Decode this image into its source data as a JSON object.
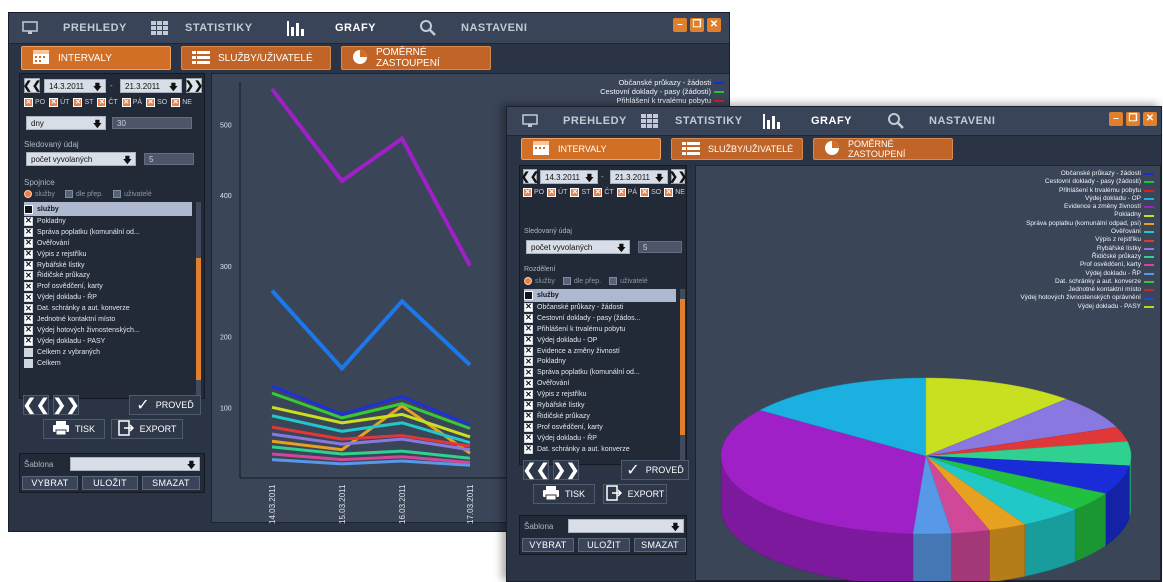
{
  "tabs": [
    {
      "label": "PREHLEDY",
      "icon": "monitor-icon"
    },
    {
      "label": "STATISTIKY",
      "icon": "grid-icon"
    },
    {
      "label": "GRAFY",
      "icon": "bar-chart-icon",
      "active": true
    },
    {
      "label": "NASTAVENI",
      "icon": "wrench-icon"
    }
  ],
  "subtabs": {
    "intervals": "INTERVALY",
    "services": "SLUŽBY/UŽIVATELÉ",
    "ratio": "POMĚRNÉ ZASTOUPENÍ"
  },
  "date_from": "14.3.2011",
  "date_to": "21.3.2011",
  "date_sep": "-",
  "days": [
    "PO",
    "ÚT",
    "ST",
    "ČT",
    "PÁ",
    "SO",
    "NE"
  ],
  "period_unit": "dny",
  "period_count": "30",
  "tracked_label": "Sledovaný údaj",
  "tracked_value": "počet vyvolaných",
  "tracked_count": "5",
  "w1_group_label": "Spojnice",
  "w2_group_label": "Rozdělení",
  "radios": [
    "služby",
    "dle přep.",
    "uživatelé"
  ],
  "list_header": "služby",
  "list_w1": [
    {
      "label": "Pokladny",
      "checked": true
    },
    {
      "label": "Správa poplatku (komunální od...",
      "checked": true
    },
    {
      "label": "Ověřování",
      "checked": true
    },
    {
      "label": "Výpis z rejstříku",
      "checked": true
    },
    {
      "label": "Rybářské lístky",
      "checked": true
    },
    {
      "label": "Řidičské průkazy",
      "checked": true
    },
    {
      "label": "Prof osvědčení, karty",
      "checked": true
    },
    {
      "label": "Výdej dokladu - ŘP",
      "checked": true
    },
    {
      "label": "Dat. schránky a aut. konverze",
      "checked": true
    },
    {
      "label": "Jednotné kontaktní místo",
      "checked": true
    },
    {
      "label": "Výdej hotových živnostenských...",
      "checked": true
    },
    {
      "label": "Výdej dokladu - PASY",
      "checked": true
    },
    {
      "label": "Celkem z vybraných",
      "checked": false
    },
    {
      "label": "Celkem",
      "checked": false
    }
  ],
  "list_w2": [
    {
      "label": "Občanské průkazy - žádosti",
      "checked": true
    },
    {
      "label": "Cestovní doklady - pasy (žádos...",
      "checked": true
    },
    {
      "label": "Přihlášení k trvalému pobytu",
      "checked": true
    },
    {
      "label": "Výdej dokladu - OP",
      "checked": true
    },
    {
      "label": "Evidence a změny živností",
      "checked": true
    },
    {
      "label": "Pokladny",
      "checked": true
    },
    {
      "label": "Správa poplatku (komunální od...",
      "checked": true
    },
    {
      "label": "Ověřování",
      "checked": true
    },
    {
      "label": "Výpis z rejstříku",
      "checked": true
    },
    {
      "label": "Rybářské lístky",
      "checked": true
    },
    {
      "label": "Řidičské průkazy",
      "checked": true
    },
    {
      "label": "Prof osvědčení, karty",
      "checked": true
    },
    {
      "label": "Výdej dokladu - ŘP",
      "checked": true
    },
    {
      "label": "Dat. schránky a aut. konverze",
      "checked": true
    }
  ],
  "run_label": "PROVEĎ",
  "print_label": "TISK",
  "export_label": "EXPORT",
  "template_label": "Šablona",
  "template_buttons": [
    "VYBRAT",
    "ULOŽIT",
    "SMAZAT"
  ],
  "colors": {
    "accent": "#e0802c",
    "bg": "#2b3444",
    "plot": "#3a4558"
  },
  "chart_w1": {
    "type": "line",
    "x": [
      "14.03.2011",
      "15.03.2011",
      "16.03.2011",
      "17.03.2011"
    ],
    "yticks": [
      100,
      200,
      300,
      400,
      500
    ],
    "ylim": [
      0,
      560
    ],
    "legend": [
      {
        "name": "Občanské průkazy - žádosti",
        "color": "#1a2bd8"
      },
      {
        "name": "Cestovní doklady - pasy (žádosti)",
        "color": "#22c040"
      },
      {
        "name": "Přihlášení k trvalému pobytu",
        "color": "#d82020"
      }
    ],
    "series": [
      {
        "color": "#a020c8",
        "values": [
          550,
          420,
          480,
          300
        ]
      },
      {
        "color": "#1c78e8",
        "values": [
          265,
          155,
          250,
          160
        ]
      },
      {
        "color": "#2030d8",
        "values": [
          130,
          90,
          115,
          75
        ]
      },
      {
        "color": "#38c838",
        "values": [
          120,
          85,
          105,
          70
        ]
      },
      {
        "color": "#c8e020",
        "values": [
          100,
          78,
          90,
          58
        ]
      },
      {
        "color": "#20c8c8",
        "values": [
          88,
          66,
          78,
          50
        ]
      },
      {
        "color": "#e03838",
        "values": [
          72,
          55,
          60,
          45
        ]
      },
      {
        "color": "#8878e0",
        "values": [
          62,
          48,
          55,
          40
        ]
      },
      {
        "color": "#e8a020",
        "values": [
          52,
          40,
          102,
          35
        ]
      },
      {
        "color": "#30d090",
        "values": [
          44,
          34,
          38,
          28
        ]
      },
      {
        "color": "#d04898",
        "values": [
          34,
          26,
          30,
          22
        ]
      },
      {
        "color": "#5898e8",
        "values": [
          26,
          20,
          24,
          18
        ]
      }
    ]
  },
  "chart_w2": {
    "type": "pie",
    "legend": [
      {
        "name": "Občanské průkazy - žádosti",
        "color": "#1a2bd8"
      },
      {
        "name": "Cestovní doklady - pasy (žádosti)",
        "color": "#22c040"
      },
      {
        "name": "Přihlášení k trvalému pobytu",
        "color": "#d82020"
      },
      {
        "name": "Výdej dokladu - OP",
        "color": "#1ab0e0"
      },
      {
        "name": "Evidence a změny živností",
        "color": "#a020c8"
      },
      {
        "name": "Pokladny",
        "color": "#c8e020"
      },
      {
        "name": "Správa poplatku (komunální odpad, psi)",
        "color": "#e8a020"
      },
      {
        "name": "Ověřování",
        "color": "#20c8c8"
      },
      {
        "name": "Výpis z rejstříku",
        "color": "#e03838"
      },
      {
        "name": "Rybářské lístky",
        "color": "#8878e0"
      },
      {
        "name": "Řidičské průkazy",
        "color": "#30d090"
      },
      {
        "name": "Prof osvědčení, karty",
        "color": "#d04898"
      },
      {
        "name": "Výdej dokladu - ŘP",
        "color": "#5898e8"
      },
      {
        "name": "Dat. schránky a aut. konverze",
        "color": "#40c040"
      },
      {
        "name": "Jednotné kontaktní místo",
        "color": "#c82828"
      },
      {
        "name": "Výdej hotových živnostenských oprávnění",
        "color": "#2048d0"
      },
      {
        "name": "Výdej dokladu - PASY",
        "color": "#b8d820"
      }
    ],
    "slices": [
      {
        "color": "#a020c8",
        "value": 34
      },
      {
        "color": "#1ab0e0",
        "value": 15
      },
      {
        "color": "#c8e020",
        "value": 12
      },
      {
        "color": "#8878e0",
        "value": 7
      },
      {
        "color": "#e03838",
        "value": 3
      },
      {
        "color": "#30d090",
        "value": 5
      },
      {
        "color": "#1a2bd8",
        "value": 6
      },
      {
        "color": "#22c040",
        "value": 4
      },
      {
        "color": "#20c8c8",
        "value": 5
      },
      {
        "color": "#e8a020",
        "value": 3
      },
      {
        "color": "#d04898",
        "value": 3
      },
      {
        "color": "#5898e8",
        "value": 3
      }
    ]
  }
}
